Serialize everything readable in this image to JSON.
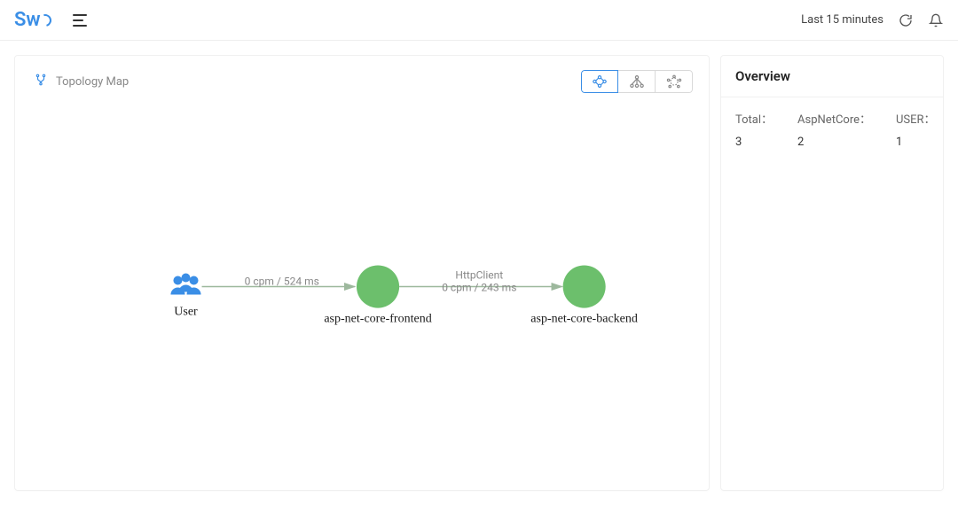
{
  "header": {
    "logo_text": "Sw",
    "timerange": "Last 15 minutes"
  },
  "topology": {
    "title": "Topology Map",
    "nodes": {
      "user": {
        "label": "User"
      },
      "frontend": {
        "label": "asp-net-core-frontend"
      },
      "backend": {
        "label": "asp-net-core-backend"
      }
    },
    "edges": {
      "user_frontend": {
        "metric": "0 cpm / 524 ms"
      },
      "frontend_backend": {
        "protocol": "HttpClient",
        "metric": "0 cpm / 243 ms"
      }
    }
  },
  "overview": {
    "title": "Overview",
    "stats": [
      {
        "label": "Total：",
        "value": "3"
      },
      {
        "label": "AspNetCore：",
        "value": "2"
      },
      {
        "label": "USER：",
        "value": "1"
      }
    ]
  }
}
